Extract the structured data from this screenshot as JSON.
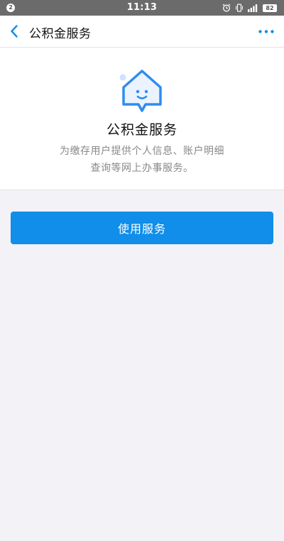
{
  "status_bar": {
    "notification_count": "2",
    "time": "11:13",
    "battery_level": "82",
    "icons": [
      "alarm-icon",
      "vibrate-icon",
      "signal-icon",
      "battery-icon"
    ]
  },
  "nav": {
    "back_icon": "chevron-left-icon",
    "title": "公积金服务",
    "more_icon": "more-dots-icon"
  },
  "intro": {
    "logo_icon": "house-smile-icon",
    "title": "公积金服务",
    "description_line1": "为缴存用户提供个人信息、账户明细",
    "description_line2": "查询等网上办事服务。"
  },
  "actions": {
    "use_service_label": "使用服务"
  },
  "colors": {
    "accent": "#108ee9",
    "status_bar": "#6b6b6b",
    "page_background": "#f2f2f7",
    "icon_light_blue": "#cfe3ff"
  }
}
